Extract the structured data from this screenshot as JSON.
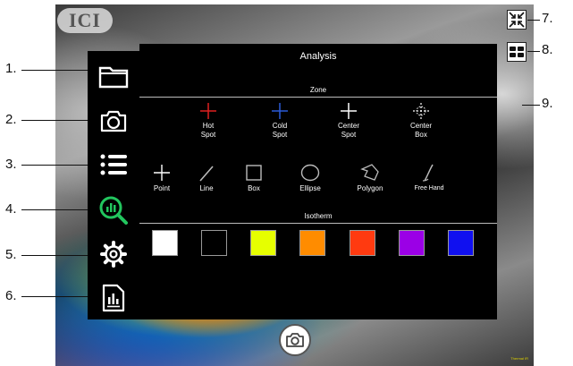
{
  "app": {
    "logo": "ICI",
    "corner_text": "Thermal IR"
  },
  "panel": {
    "title": "Analysis",
    "zone_label": "Zone",
    "isotherm_label": "Isotherm",
    "zone_tools": [
      {
        "line1": "Hot",
        "line2": "Spot",
        "icon": "crosshair-icon",
        "color": "#e02020"
      },
      {
        "line1": "Cold",
        "line2": "Spot",
        "icon": "crosshair-icon",
        "color": "#2a5bd8"
      },
      {
        "line1": "Center",
        "line2": "Spot",
        "icon": "crosshair-icon",
        "color": "#ffffff"
      },
      {
        "line1": "Center",
        "line2": "Box",
        "icon": "dotted-target-icon",
        "color": "#ffffff"
      }
    ],
    "shape_tools": [
      "Point",
      "Line",
      "Box",
      "Ellipse",
      "Polygon",
      "Free Hand"
    ],
    "isotherm_colors": [
      "#ffffff",
      "#000000",
      "#e6ff00",
      "#ff8c00",
      "#ff3a10",
      "#9b00e6",
      "#1010f0"
    ]
  },
  "sidebar": [
    {
      "icon": "folder-icon",
      "callout": "1."
    },
    {
      "icon": "camera-icon",
      "callout": "2."
    },
    {
      "icon": "list-icon",
      "callout": "3."
    },
    {
      "icon": "analysis-magnifier-icon",
      "callout": "4.",
      "accent": "#22c55e"
    },
    {
      "icon": "gear-icon",
      "callout": "5."
    },
    {
      "icon": "report-icon",
      "callout": "6."
    }
  ],
  "right_buttons": [
    {
      "icon": "collapse-arrows-icon",
      "callout": "7."
    },
    {
      "icon": "layout-toggle-icon",
      "callout": "8."
    }
  ],
  "image_callout": "9."
}
